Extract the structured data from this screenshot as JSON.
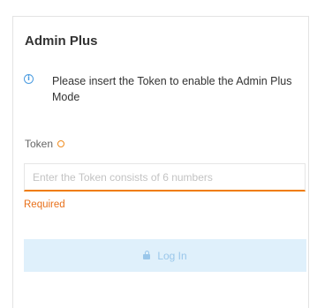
{
  "panel": {
    "title": "Admin Plus",
    "info_icon": "info-circle-icon",
    "info_text": "Please insert the Token to enable the Admin Plus Mode"
  },
  "form": {
    "token_label": "Token",
    "required_icon": "required-circle-icon",
    "token_value": "",
    "token_placeholder": "Enter the Token consists of 6 numbers",
    "error_text": "Required",
    "login_label": "Log In",
    "login_icon": "lock-icon"
  },
  "colors": {
    "accent_error": "#f07c00",
    "info": "#4a9be0",
    "button_bg_disabled": "#dff0fb",
    "button_text_disabled": "#9ac7ea"
  }
}
